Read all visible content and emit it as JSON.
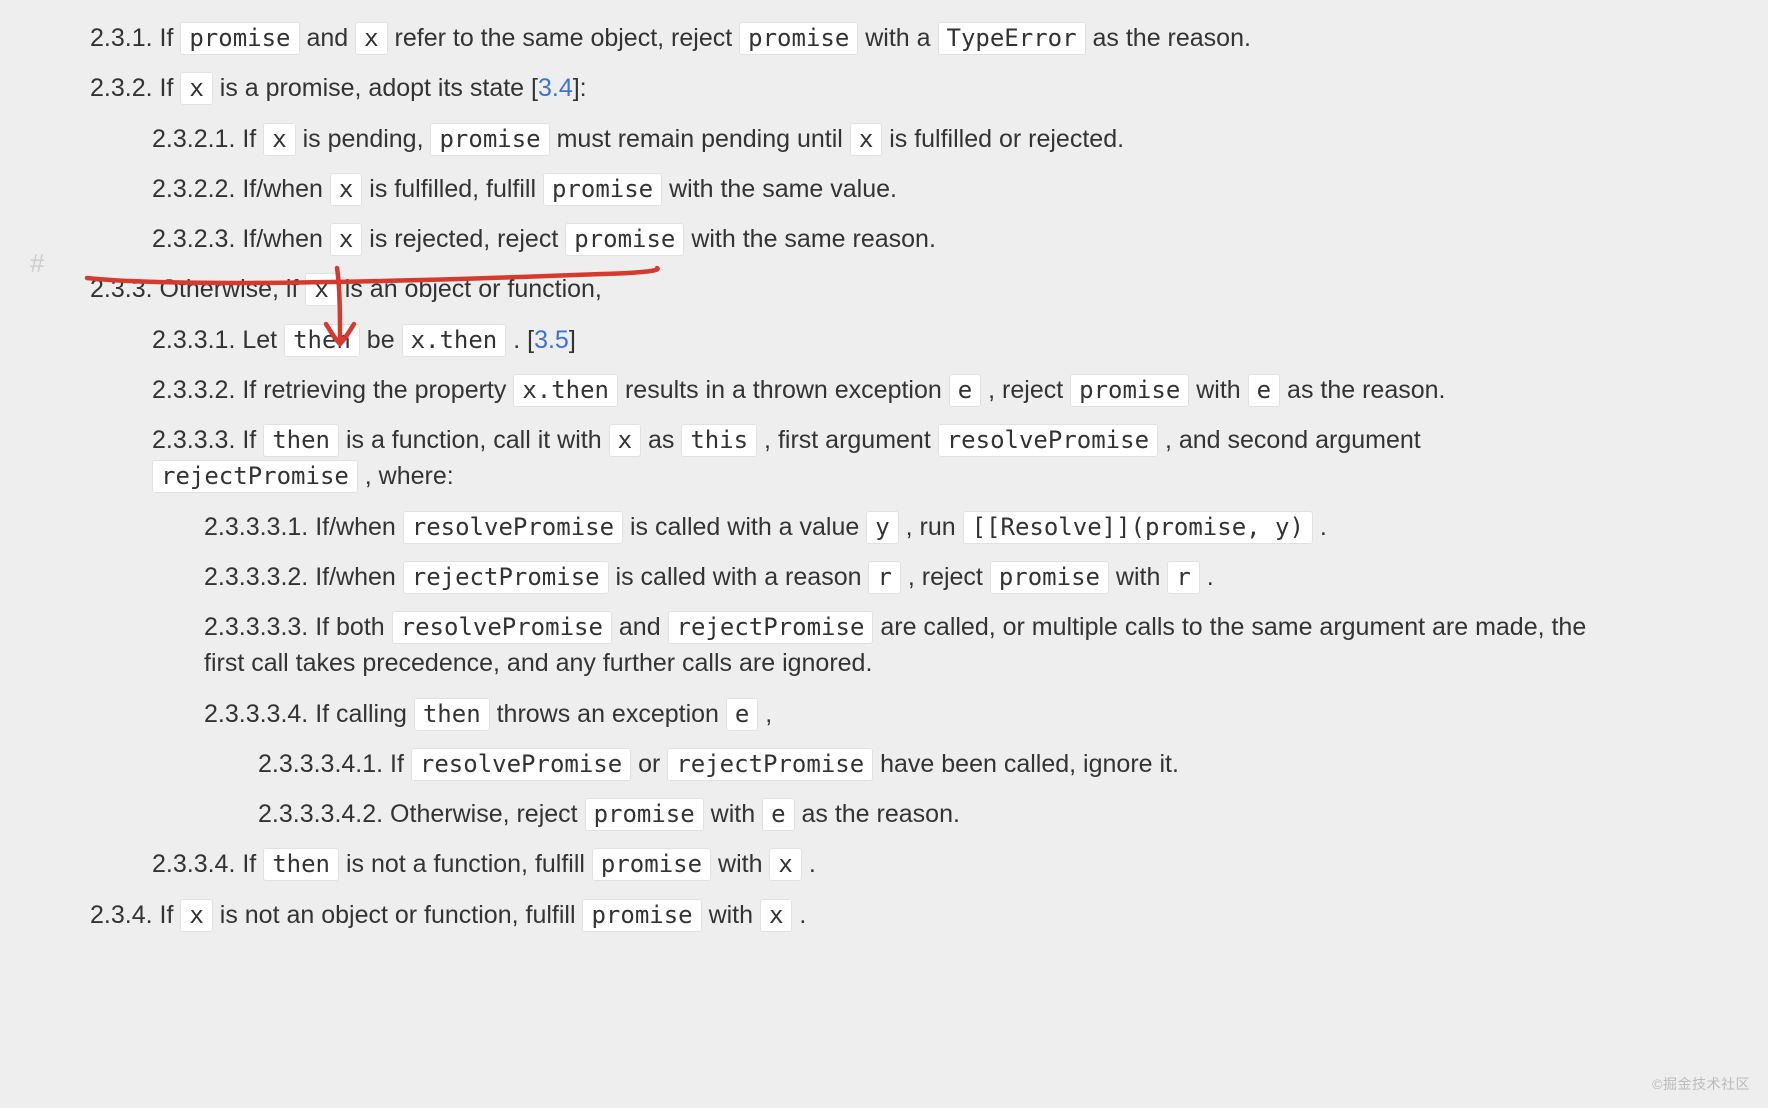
{
  "hash": "#",
  "watermark": "©掘金技术社区",
  "s231": {
    "num": "2.3.1.",
    "t1": " If ",
    "c1": "promise",
    "t2": " and ",
    "c2": "x",
    "t3": " refer to the same object, reject ",
    "c3": "promise",
    "t4": " with a ",
    "c4": "TypeError",
    "t5": " as the reason."
  },
  "s232": {
    "num": "2.3.2.",
    "t1": " If ",
    "c1": "x",
    "t2": " is a promise, adopt its state [",
    "link": "3.4",
    "t3": "]:"
  },
  "s2321": {
    "num": "2.3.2.1.",
    "t1": " If ",
    "c1": "x",
    "t2": " is pending, ",
    "c2": "promise",
    "t3": " must remain pending until ",
    "c3": "x",
    "t4": " is fulfilled or rejected."
  },
  "s2322": {
    "num": "2.3.2.2.",
    "t1": " If/when ",
    "c1": "x",
    "t2": " is fulfilled, fulfill ",
    "c2": "promise",
    "t3": " with the same value."
  },
  "s2323": {
    "num": "2.3.2.3.",
    "t1": " If/when ",
    "c1": "x",
    "t2": " is rejected, reject ",
    "c2": "promise",
    "t3": " with the same reason."
  },
  "s233": {
    "num": "2.3.3.",
    "t1": " Otherwise, if ",
    "c1": "x",
    "t2": " is an object or function,"
  },
  "s2331": {
    "num": "2.3.3.1.",
    "t1": " Let ",
    "c1": "then",
    "t2": " be ",
    "c2": "x.then",
    "t3": " . [",
    "link": "3.5",
    "t4": "]"
  },
  "s2332": {
    "num": "2.3.3.2.",
    "t1": " If retrieving the property ",
    "c1": "x.then",
    "t2": " results in a thrown exception ",
    "c2": "e",
    "t3": " , reject ",
    "c3": "promise",
    "t4": " with ",
    "c4": "e",
    "t5": " as the reason."
  },
  "s2333": {
    "num": "2.3.3.3.",
    "t1": " If ",
    "c1": "then",
    "t2": " is a function, call it with ",
    "c2": "x",
    "t3": " as ",
    "c3": "this",
    "t4": " , first argument ",
    "c4": "resolvePromise",
    "t5": " , and second argument ",
    "c5": "rejectPromise",
    "t6": " , where:"
  },
  "s23331": {
    "num": "2.3.3.3.1.",
    "t1": " If/when ",
    "c1": "resolvePromise",
    "t2": " is called with a value ",
    "c2": "y",
    "t3": " , run ",
    "c3": "[[Resolve]](promise, y)",
    "t4": " ."
  },
  "s23332": {
    "num": "2.3.3.3.2.",
    "t1": " If/when ",
    "c1": "rejectPromise",
    "t2": " is called with a reason ",
    "c2": "r",
    "t3": " , reject ",
    "c3": "promise",
    "t4": " with ",
    "c4": "r",
    "t5": " ."
  },
  "s23333": {
    "num": "2.3.3.3.3.",
    "t1": " If both ",
    "c1": "resolvePromise",
    "t2": " and ",
    "c2": "rejectPromise",
    "t3": " are called, or multiple calls to the same argument are made, the first call takes precedence, and any further calls are ignored."
  },
  "s23334": {
    "num": "2.3.3.3.4.",
    "t1": " If calling ",
    "c1": "then",
    "t2": " throws an exception ",
    "c2": "e",
    "t3": " ,"
  },
  "s233341": {
    "num": "2.3.3.3.4.1.",
    "t1": " If ",
    "c1": "resolvePromise",
    "t2": " or ",
    "c2": "rejectPromise",
    "t3": " have been called, ignore it."
  },
  "s233342": {
    "num": "2.3.3.3.4.2.",
    "t1": " Otherwise, reject ",
    "c1": "promise",
    "t2": " with ",
    "c2": "e",
    "t3": " as the reason."
  },
  "s2334": {
    "num": "2.3.3.4.",
    "t1": " If ",
    "c1": "then",
    "t2": " is not a function, fulfill ",
    "c2": "promise",
    "t3": " with ",
    "c3": "x",
    "t4": " ."
  },
  "s234": {
    "num": "2.3.4.",
    "t1": " If ",
    "c1": "x",
    "t2": " is not an object or function, fulfill ",
    "c2": "promise",
    "t3": " with ",
    "c3": "x",
    "t4": " ."
  }
}
